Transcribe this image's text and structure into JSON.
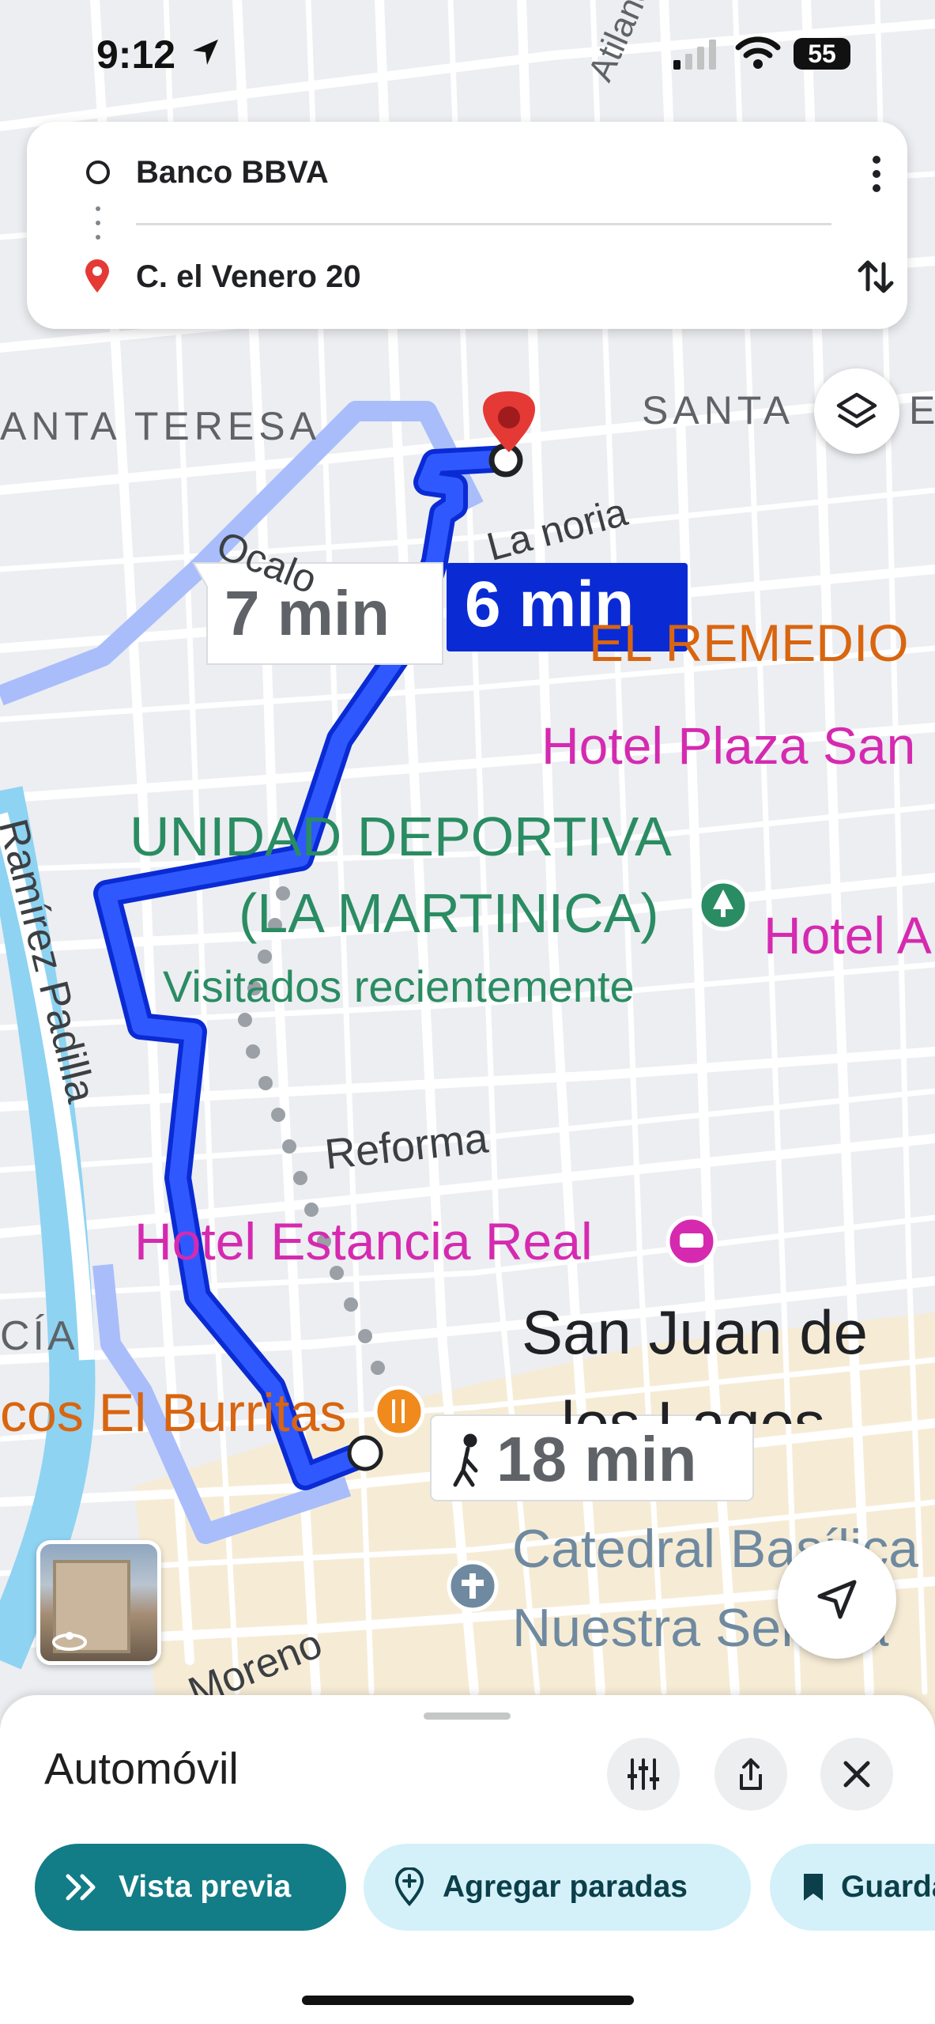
{
  "status_bar": {
    "time": "9:12",
    "battery": "55"
  },
  "route": {
    "origin": "Banco BBVA",
    "destination": "C. el Venero 20"
  },
  "map": {
    "route_times": {
      "alternate": "7 min",
      "selected": "6 min",
      "walking": "18 min"
    },
    "labels": {
      "santa_teresa": "ANTA TERESA",
      "santa_right": "SANTA",
      "santa_right_cut": "E",
      "atilano": "Atilano",
      "ocalo": "Ocalo",
      "la_noria": "La noria",
      "el_remedio": "EL REMEDIO",
      "hotel_plaza": "Hotel Plaza San",
      "unidad_1": "UNIDAD DEPORTIVA",
      "unidad_2": "(LA MARTINICA)",
      "recent": "Visitados recientemente",
      "hotel_a": "Hotel A",
      "ramirez": "Ramírez Padilla",
      "reforma": "Reforma",
      "hotel_estancia": "Hotel Estancia Real",
      "cia": "CÍA",
      "burritas": "cos El Burritas",
      "sanjuan_1": "San Juan de",
      "sanjuan_2": "los Lagos",
      "catedral_1": "Catedral Basílica",
      "catedral_2": "Nuestra Señora",
      "moreno": "Moreno"
    }
  },
  "bottom_sheet": {
    "mode": "Automóvil",
    "buttons": {
      "preview": "Vista previa",
      "add_stops": "Agregar paradas",
      "save": "Guardar"
    }
  },
  "colors": {
    "route_blue": "#1a3fe6",
    "alt_route": "#a9bdfb",
    "teal": "#127c87",
    "hotel": "#d52ab0",
    "park": "#2a8c62",
    "food": "#d9650f",
    "river": "#8ed3f2"
  }
}
